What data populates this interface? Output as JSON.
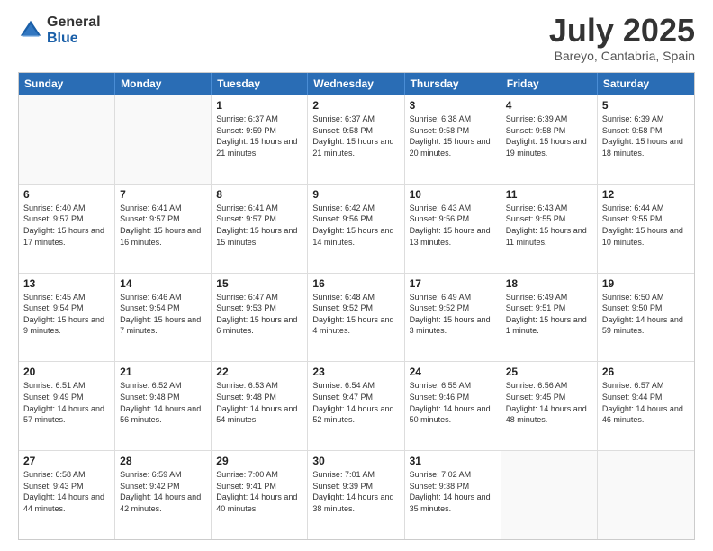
{
  "logo": {
    "general": "General",
    "blue": "Blue"
  },
  "title": {
    "month": "July 2025",
    "location": "Bareyo, Cantabria, Spain"
  },
  "header_days": [
    "Sunday",
    "Monday",
    "Tuesday",
    "Wednesday",
    "Thursday",
    "Friday",
    "Saturday"
  ],
  "weeks": [
    [
      {
        "day": "",
        "info": "",
        "empty": true
      },
      {
        "day": "",
        "info": "",
        "empty": true
      },
      {
        "day": "1",
        "info": "Sunrise: 6:37 AM\nSunset: 9:59 PM\nDaylight: 15 hours and 21 minutes."
      },
      {
        "day": "2",
        "info": "Sunrise: 6:37 AM\nSunset: 9:58 PM\nDaylight: 15 hours and 21 minutes."
      },
      {
        "day": "3",
        "info": "Sunrise: 6:38 AM\nSunset: 9:58 PM\nDaylight: 15 hours and 20 minutes."
      },
      {
        "day": "4",
        "info": "Sunrise: 6:39 AM\nSunset: 9:58 PM\nDaylight: 15 hours and 19 minutes."
      },
      {
        "day": "5",
        "info": "Sunrise: 6:39 AM\nSunset: 9:58 PM\nDaylight: 15 hours and 18 minutes."
      }
    ],
    [
      {
        "day": "6",
        "info": "Sunrise: 6:40 AM\nSunset: 9:57 PM\nDaylight: 15 hours and 17 minutes."
      },
      {
        "day": "7",
        "info": "Sunrise: 6:41 AM\nSunset: 9:57 PM\nDaylight: 15 hours and 16 minutes."
      },
      {
        "day": "8",
        "info": "Sunrise: 6:41 AM\nSunset: 9:57 PM\nDaylight: 15 hours and 15 minutes."
      },
      {
        "day": "9",
        "info": "Sunrise: 6:42 AM\nSunset: 9:56 PM\nDaylight: 15 hours and 14 minutes."
      },
      {
        "day": "10",
        "info": "Sunrise: 6:43 AM\nSunset: 9:56 PM\nDaylight: 15 hours and 13 minutes."
      },
      {
        "day": "11",
        "info": "Sunrise: 6:43 AM\nSunset: 9:55 PM\nDaylight: 15 hours and 11 minutes."
      },
      {
        "day": "12",
        "info": "Sunrise: 6:44 AM\nSunset: 9:55 PM\nDaylight: 15 hours and 10 minutes."
      }
    ],
    [
      {
        "day": "13",
        "info": "Sunrise: 6:45 AM\nSunset: 9:54 PM\nDaylight: 15 hours and 9 minutes."
      },
      {
        "day": "14",
        "info": "Sunrise: 6:46 AM\nSunset: 9:54 PM\nDaylight: 15 hours and 7 minutes."
      },
      {
        "day": "15",
        "info": "Sunrise: 6:47 AM\nSunset: 9:53 PM\nDaylight: 15 hours and 6 minutes."
      },
      {
        "day": "16",
        "info": "Sunrise: 6:48 AM\nSunset: 9:52 PM\nDaylight: 15 hours and 4 minutes."
      },
      {
        "day": "17",
        "info": "Sunrise: 6:49 AM\nSunset: 9:52 PM\nDaylight: 15 hours and 3 minutes."
      },
      {
        "day": "18",
        "info": "Sunrise: 6:49 AM\nSunset: 9:51 PM\nDaylight: 15 hours and 1 minute."
      },
      {
        "day": "19",
        "info": "Sunrise: 6:50 AM\nSunset: 9:50 PM\nDaylight: 14 hours and 59 minutes."
      }
    ],
    [
      {
        "day": "20",
        "info": "Sunrise: 6:51 AM\nSunset: 9:49 PM\nDaylight: 14 hours and 57 minutes."
      },
      {
        "day": "21",
        "info": "Sunrise: 6:52 AM\nSunset: 9:48 PM\nDaylight: 14 hours and 56 minutes."
      },
      {
        "day": "22",
        "info": "Sunrise: 6:53 AM\nSunset: 9:48 PM\nDaylight: 14 hours and 54 minutes."
      },
      {
        "day": "23",
        "info": "Sunrise: 6:54 AM\nSunset: 9:47 PM\nDaylight: 14 hours and 52 minutes."
      },
      {
        "day": "24",
        "info": "Sunrise: 6:55 AM\nSunset: 9:46 PM\nDaylight: 14 hours and 50 minutes."
      },
      {
        "day": "25",
        "info": "Sunrise: 6:56 AM\nSunset: 9:45 PM\nDaylight: 14 hours and 48 minutes."
      },
      {
        "day": "26",
        "info": "Sunrise: 6:57 AM\nSunset: 9:44 PM\nDaylight: 14 hours and 46 minutes."
      }
    ],
    [
      {
        "day": "27",
        "info": "Sunrise: 6:58 AM\nSunset: 9:43 PM\nDaylight: 14 hours and 44 minutes."
      },
      {
        "day": "28",
        "info": "Sunrise: 6:59 AM\nSunset: 9:42 PM\nDaylight: 14 hours and 42 minutes."
      },
      {
        "day": "29",
        "info": "Sunrise: 7:00 AM\nSunset: 9:41 PM\nDaylight: 14 hours and 40 minutes."
      },
      {
        "day": "30",
        "info": "Sunrise: 7:01 AM\nSunset: 9:39 PM\nDaylight: 14 hours and 38 minutes."
      },
      {
        "day": "31",
        "info": "Sunrise: 7:02 AM\nSunset: 9:38 PM\nDaylight: 14 hours and 35 minutes."
      },
      {
        "day": "",
        "info": "",
        "empty": true
      },
      {
        "day": "",
        "info": "",
        "empty": true
      }
    ]
  ]
}
